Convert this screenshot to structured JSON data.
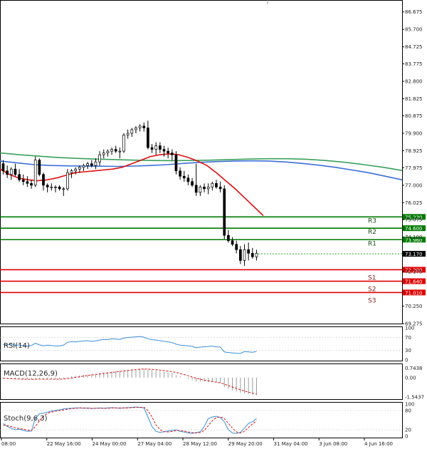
{
  "chart_data": {
    "type": "candlestick",
    "instrument_note": "",
    "main": {
      "ylim": [
        69.275,
        87.3
      ],
      "y_ticks": [
        86.675,
        85.7,
        84.725,
        83.775,
        82.8,
        81.825,
        80.875,
        79.9,
        78.925,
        77.975,
        77.0,
        76.025,
        75.075,
        74.1,
        72.175,
        70.25,
        69.275
      ],
      "last_price": 73.17,
      "levels": [
        {
          "name": "R3",
          "value": 75.23,
          "tag": "75.230",
          "color": "#007a00"
        },
        {
          "name": "R2",
          "value": 74.6,
          "tag": "74.600",
          "color": "#007a00"
        },
        {
          "name": "R1",
          "value": 73.96,
          "tag": "73.960",
          "color": "#007a00"
        },
        {
          "name": "S1",
          "value": 72.28,
          "tag": "72.280",
          "color": "#e00000"
        },
        {
          "name": "S2",
          "value": 71.64,
          "tag": "71.640",
          "color": "#e00000"
        },
        {
          "name": "S3",
          "value": 71.01,
          "tag": "71.010",
          "color": "#e00000"
        }
      ],
      "candles": [
        [
          78.2,
          78.4,
          77.6,
          77.8
        ],
        [
          77.8,
          78.1,
          77.4,
          77.6
        ],
        [
          77.6,
          78.0,
          77.3,
          77.9
        ],
        [
          77.9,
          78.2,
          77.5,
          77.6
        ],
        [
          77.6,
          77.9,
          77.2,
          77.3
        ],
        [
          77.3,
          77.6,
          77.0,
          77.2
        ],
        [
          77.2,
          77.5,
          76.9,
          77.1
        ],
        [
          77.1,
          77.3,
          76.8,
          77.0
        ],
        [
          77.0,
          78.6,
          76.9,
          78.4
        ],
        [
          78.4,
          78.5,
          77.5,
          77.6
        ],
        [
          77.6,
          77.7,
          76.7,
          77.0
        ],
        [
          77.0,
          77.1,
          76.6,
          76.9
        ],
        [
          76.9,
          77.1,
          76.7,
          76.9
        ],
        [
          76.9,
          77.0,
          76.6,
          76.9
        ],
        [
          76.9,
          77.0,
          76.7,
          76.8
        ],
        [
          76.8,
          76.9,
          76.4,
          76.8
        ],
        [
          76.8,
          77.9,
          76.7,
          77.7
        ],
        [
          77.7,
          77.9,
          77.4,
          77.8
        ],
        [
          77.8,
          78.0,
          77.6,
          77.9
        ],
        [
          77.9,
          78.1,
          77.7,
          78.0
        ],
        [
          78.0,
          78.2,
          77.8,
          78.1
        ],
        [
          78.1,
          78.3,
          77.9,
          78.2
        ],
        [
          78.2,
          78.4,
          78.0,
          78.1
        ],
        [
          78.1,
          78.5,
          77.9,
          78.3
        ],
        [
          78.3,
          78.9,
          78.1,
          78.7
        ],
        [
          78.7,
          79.0,
          78.5,
          78.8
        ],
        [
          78.8,
          79.0,
          78.6,
          78.9
        ],
        [
          78.9,
          79.1,
          78.7,
          79.0
        ],
        [
          79.0,
          79.2,
          78.8,
          78.9
        ],
        [
          78.9,
          79.1,
          78.5,
          78.9
        ],
        [
          78.9,
          79.9,
          78.8,
          79.8
        ],
        [
          79.8,
          80.1,
          79.6,
          79.9
        ],
        [
          79.9,
          80.2,
          79.7,
          80.1
        ],
        [
          80.1,
          80.3,
          79.9,
          80.2
        ],
        [
          80.2,
          80.4,
          80.0,
          80.3
        ],
        [
          80.3,
          80.5,
          80.0,
          80.2
        ],
        [
          80.2,
          80.6,
          79.0,
          79.1
        ],
        [
          79.1,
          79.3,
          78.8,
          79.0
        ],
        [
          79.0,
          79.4,
          78.7,
          79.2
        ],
        [
          79.2,
          79.4,
          78.8,
          79.0
        ],
        [
          79.0,
          79.2,
          78.6,
          78.9
        ],
        [
          78.9,
          79.1,
          78.5,
          78.8
        ],
        [
          78.8,
          79.0,
          78.4,
          78.7
        ],
        [
          78.7,
          78.9,
          77.6,
          77.8
        ],
        [
          77.8,
          78.0,
          77.3,
          77.5
        ],
        [
          77.5,
          77.8,
          77.2,
          77.4
        ],
        [
          77.4,
          77.6,
          77.0,
          77.2
        ],
        [
          77.2,
          77.4,
          76.9,
          77.0
        ],
        [
          77.0,
          78.2,
          76.4,
          76.6
        ],
        [
          76.6,
          77.0,
          76.4,
          76.9
        ],
        [
          76.9,
          77.1,
          76.6,
          76.8
        ],
        [
          76.8,
          77.1,
          76.5,
          76.9
        ],
        [
          76.9,
          77.2,
          76.7,
          77.1
        ],
        [
          77.1,
          77.3,
          76.8,
          76.9
        ],
        [
          76.9,
          77.2,
          76.6,
          76.8
        ],
        [
          76.8,
          77.0,
          74.0,
          74.2
        ],
        [
          74.2,
          74.5,
          73.8,
          73.9
        ],
        [
          73.9,
          74.1,
          73.6,
          73.7
        ],
        [
          73.7,
          73.9,
          73.2,
          73.4
        ],
        [
          73.4,
          73.6,
          72.6,
          72.8
        ],
        [
          72.8,
          73.7,
          72.5,
          73.4
        ],
        [
          73.4,
          73.8,
          72.8,
          73.2
        ],
        [
          73.2,
          73.5,
          72.9,
          73.0
        ],
        [
          73.0,
          73.4,
          72.8,
          73.2
        ]
      ],
      "sma_fast": [
        77.9,
        77.6,
        77.4,
        77.3,
        77.25,
        77.3,
        77.4,
        77.55,
        77.7,
        77.75,
        77.8,
        77.85,
        77.9,
        78.0,
        78.2,
        78.4,
        78.6,
        78.7,
        78.75,
        78.7,
        78.55,
        78.35,
        78.1,
        77.7,
        77.25,
        76.8,
        76.3,
        75.8,
        75.3
      ],
      "sma_mid": [
        78.35,
        78.25,
        78.15,
        78.1,
        78.08,
        78.07,
        78.06,
        78.05,
        78.07,
        78.1,
        78.15,
        78.22,
        78.28,
        78.32,
        78.35,
        78.36,
        78.35,
        78.3,
        78.22,
        78.12,
        78.0,
        77.85,
        77.7,
        77.5,
        77.3
      ],
      "sma_slow": [
        78.8,
        78.7,
        78.62,
        78.55,
        78.5,
        78.46,
        78.43,
        78.4,
        78.38,
        78.37,
        78.38,
        78.4,
        78.43,
        78.46,
        78.48,
        78.48,
        78.45,
        78.38,
        78.28,
        78.15,
        78.0,
        77.82
      ]
    },
    "rsi": {
      "label": "RSI(14)",
      "ylim": [
        0,
        100
      ],
      "y_ticks": [
        "100",
        "70",
        "30",
        "0"
      ],
      "values": [
        48,
        46,
        50,
        45,
        47,
        44,
        43,
        45,
        52,
        47,
        44,
        46,
        45,
        43,
        44,
        46,
        55,
        57,
        56,
        58,
        59,
        60,
        58,
        59,
        62,
        64,
        63,
        66,
        65,
        64,
        68,
        70,
        71,
        72,
        73,
        71,
        66,
        63,
        62,
        60,
        58,
        56,
        54,
        49,
        46,
        45,
        44,
        42,
        38,
        40,
        41,
        42,
        43,
        41,
        40,
        25,
        23,
        22,
        21,
        20,
        26,
        25,
        24,
        26
      ]
    },
    "macd": {
      "label": "MACD(12,26,9)",
      "ylim": [
        -1.6,
        0.9
      ],
      "y_ticks": [
        "0.7438",
        "0.00",
        "-1.5437"
      ],
      "histogram": [
        -0.05,
        -0.08,
        -0.1,
        -0.12,
        -0.13,
        -0.14,
        -0.15,
        -0.16,
        -0.1,
        -0.09,
        -0.11,
        -0.12,
        -0.12,
        -0.13,
        -0.12,
        -0.1,
        0.05,
        0.1,
        0.15,
        0.18,
        0.22,
        0.25,
        0.28,
        0.3,
        0.35,
        0.4,
        0.45,
        0.5,
        0.52,
        0.55,
        0.6,
        0.62,
        0.65,
        0.68,
        0.7,
        0.7,
        0.65,
        0.6,
        0.55,
        0.5,
        0.45,
        0.4,
        0.35,
        0.2,
        0.1,
        0.0,
        -0.1,
        -0.2,
        -0.3,
        -0.32,
        -0.34,
        -0.35,
        -0.36,
        -0.38,
        -0.4,
        -0.75,
        -0.9,
        -1.0,
        -1.1,
        -1.2,
        -1.25,
        -1.3,
        -1.35,
        -1.4
      ],
      "signal": [
        -0.05,
        -0.07,
        -0.09,
        -0.1,
        -0.11,
        -0.12,
        -0.13,
        -0.14,
        -0.13,
        -0.12,
        -0.12,
        -0.12,
        -0.12,
        -0.12,
        -0.12,
        -0.11,
        -0.07,
        -0.03,
        0.02,
        0.07,
        0.12,
        0.17,
        0.21,
        0.25,
        0.29,
        0.33,
        0.37,
        0.41,
        0.45,
        0.49,
        0.53,
        0.57,
        0.61,
        0.64,
        0.67,
        0.69,
        0.68,
        0.66,
        0.63,
        0.6,
        0.56,
        0.52,
        0.48,
        0.41,
        0.33,
        0.24,
        0.15,
        0.05,
        -0.05,
        -0.13,
        -0.2,
        -0.26,
        -0.31,
        -0.36,
        -0.41,
        -0.52,
        -0.63,
        -0.75,
        -0.86,
        -0.97,
        -1.07,
        -1.16,
        -1.24,
        -1.31
      ]
    },
    "stoch": {
      "label": "Stoch(9,6,3)",
      "ylim": [
        0,
        100
      ],
      "y_ticks": [
        "100",
        "80",
        "20",
        "0"
      ],
      "main_line": [
        40,
        30,
        25,
        20,
        22,
        18,
        15,
        16,
        55,
        70,
        72,
        75,
        78,
        80,
        82,
        85,
        86,
        87,
        88,
        88,
        87,
        88,
        86,
        87,
        88,
        87,
        88,
        89,
        88,
        87,
        88,
        89,
        90,
        91,
        90,
        88,
        60,
        30,
        15,
        12,
        14,
        16,
        18,
        20,
        15,
        13,
        10,
        9,
        11,
        14,
        30,
        55,
        60,
        62,
        58,
        45,
        20,
        10,
        8,
        12,
        25,
        40,
        45,
        55
      ],
      "signal_line": [
        35,
        33,
        30,
        26,
        24,
        22,
        19,
        17,
        30,
        48,
        62,
        72,
        75,
        78,
        80,
        82,
        84,
        86,
        87,
        88,
        88,
        87,
        87,
        87,
        87,
        87,
        87,
        88,
        88,
        88,
        88,
        88,
        89,
        90,
        90,
        90,
        80,
        60,
        35,
        20,
        14,
        13,
        15,
        17,
        18,
        16,
        13,
        11,
        10,
        11,
        18,
        33,
        48,
        58,
        60,
        55,
        40,
        25,
        13,
        10,
        15,
        27,
        38,
        48
      ]
    },
    "x_ticks": [
      "08:00",
      "22 May 16:00",
      "24 May 00:00",
      "27 May 04:00",
      "28 May 12:00",
      "29 May 20:00",
      "31 May 04:00",
      "3 Jun 08:00",
      "4 Jun 16:00"
    ]
  }
}
